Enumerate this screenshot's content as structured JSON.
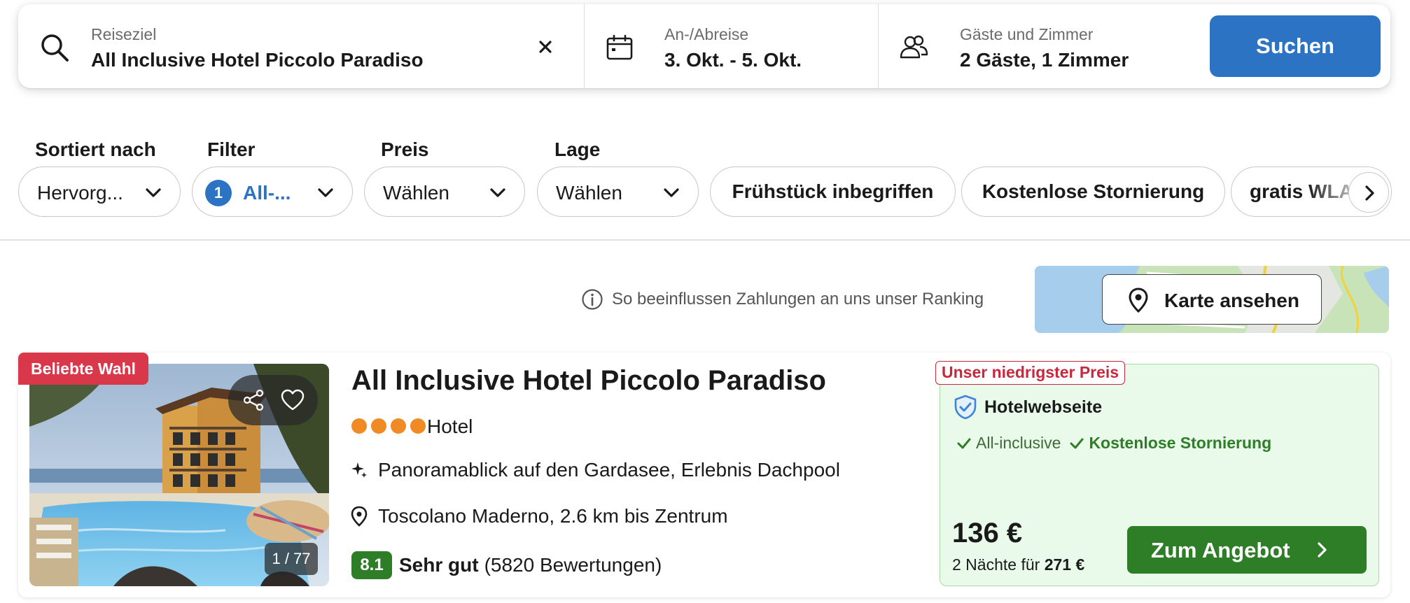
{
  "search": {
    "destination_label": "Reiseziel",
    "destination_value": "All Inclusive Hotel Piccolo Paradiso",
    "dates_label": "An-/Abreise",
    "dates_value": "3. Okt. - 5. Okt.",
    "guests_label": "Gäste und Zimmer",
    "guests_value": "2 Gäste, 1 Zimmer",
    "search_button": "Suchen"
  },
  "filters": {
    "sort_label": "Sortiert nach",
    "sort_value": "Hervorg...",
    "filter_label": "Filter",
    "filter_count": "1",
    "filter_value": "All-...",
    "price_label": "Preis",
    "price_value": "Wählen",
    "location_label": "Lage",
    "location_value": "Wählen",
    "chips": [
      "Frühstück inbegriffen",
      "Kostenlose Stornierung",
      "gratis WLAN"
    ]
  },
  "ranking_info": "So beeinflussen Zahlungen an uns unser Ranking",
  "map_button": "Karte ansehen",
  "hotel": {
    "tag": "Beliebte Wahl",
    "photo_counter": "1 / 77",
    "name": "All Inclusive Hotel Piccolo Paradiso",
    "stars": 4,
    "type": "Hotel",
    "highlight": "Panoramablick auf den Gardasee, Erlebnis Dachpool",
    "location": "Toscolano Maderno, 2.6 km bis Zentrum",
    "rating_score": "8.1",
    "rating_label": "Sehr gut",
    "rating_count": "(5820 Bewertungen)"
  },
  "offer": {
    "badge": "Unser niedrigster Preis",
    "provider": "Hotelwebseite",
    "amenity_1": "All-inclusive",
    "amenity_2": "Kostenlose Stornierung",
    "price": "136 €",
    "nights_prefix": "2 Nächte für",
    "nights_total": "271 €",
    "button": "Zum Angebot"
  },
  "colors": {
    "brand_blue": "#2c73c4",
    "offer_green": "#2e7d27",
    "popular_red": "#d9374a",
    "star_orange": "#f08a24"
  }
}
